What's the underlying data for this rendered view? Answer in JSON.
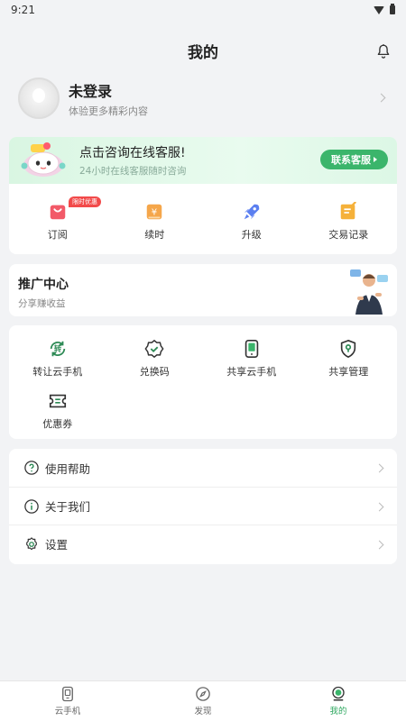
{
  "status_bar": {
    "time": "9:21"
  },
  "header": {
    "title": "我的"
  },
  "profile": {
    "name": "未登录",
    "subtitle": "体验更多精彩内容"
  },
  "service": {
    "title": "点击咨询在线客服!",
    "subtitle": "24小时在线客服随时咨询",
    "button_label": "联系客服"
  },
  "quick_actions": [
    {
      "label": "订阅",
      "icon": "subscribe-bag-icon",
      "badge": "限时优惠"
    },
    {
      "label": "续时",
      "icon": "renew-time-icon"
    },
    {
      "label": "升级",
      "icon": "rocket-upgrade-icon"
    },
    {
      "label": "交易记录",
      "icon": "transaction-record-icon"
    }
  ],
  "promotion": {
    "title": "推广中心",
    "subtitle": "分享赚收益"
  },
  "tools": [
    {
      "label": "转让云手机",
      "icon": "transfer-icon"
    },
    {
      "label": "兑换码",
      "icon": "redeem-code-icon"
    },
    {
      "label": "共享云手机",
      "icon": "share-phone-icon"
    },
    {
      "label": "共享管理",
      "icon": "share-manage-icon"
    },
    {
      "label": "优惠券",
      "icon": "coupon-icon"
    }
  ],
  "menu": [
    {
      "label": "使用帮助",
      "icon": "help-icon"
    },
    {
      "label": "关于我们",
      "icon": "info-icon"
    },
    {
      "label": "设置",
      "icon": "settings-gear-icon"
    }
  ],
  "bottom_nav": [
    {
      "label": "云手机",
      "icon": "cloud-phone-icon",
      "active": false
    },
    {
      "label": "发现",
      "icon": "compass-icon",
      "active": false
    },
    {
      "label": "我的",
      "icon": "profile-icon",
      "active": true
    }
  ],
  "colors": {
    "accent": "#3bb56b",
    "badge": "#f24a4a",
    "background": "#f2f3f5"
  }
}
